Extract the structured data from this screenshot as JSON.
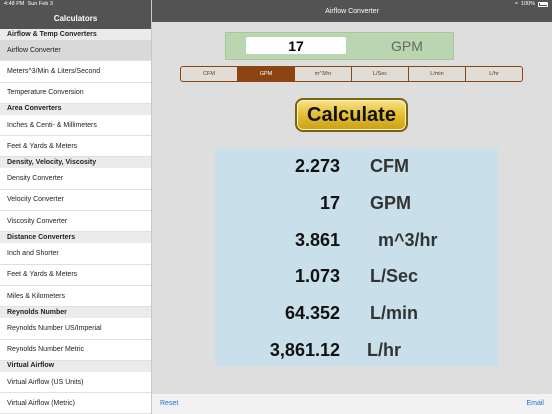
{
  "status": {
    "time": "4:48 PM",
    "date": "Sun Feb 3",
    "battery": "100%"
  },
  "sidebar": {
    "title": "Calculators",
    "groups": [
      {
        "section": "Airflow & Temp Converters",
        "items": [
          {
            "label": "Airflow Converter",
            "selected": true
          },
          {
            "label": "Meters^3/Min & Liters/Second"
          },
          {
            "label": "Temperature Conversion"
          }
        ]
      },
      {
        "section": "Area Converters",
        "items": [
          {
            "label": "Inches & Centi- & Millimeters"
          },
          {
            "label": "Feet & Yards & Meters"
          }
        ]
      },
      {
        "section": "Density, Velocity, Viscosity",
        "items": [
          {
            "label": "Density Converter"
          },
          {
            "label": "Velocity Converter"
          },
          {
            "label": "Viscosity Converter"
          }
        ]
      },
      {
        "section": "Distance Converters",
        "items": [
          {
            "label": "Inch and Shorter"
          },
          {
            "label": "Feet & Yards & Meters"
          },
          {
            "label": "Miles & Kilometers"
          }
        ]
      },
      {
        "section": "Reynolds Number",
        "items": [
          {
            "label": "Reynolds Number US/Imperial"
          },
          {
            "label": "Reynolds Number Metric"
          }
        ]
      },
      {
        "section": "Virtual Airflow",
        "items": [
          {
            "label": "Virtual Airflow (US Units)"
          },
          {
            "label": "Virtual Airflow (Metric)"
          }
        ]
      }
    ]
  },
  "main": {
    "title": "Airflow Converter",
    "input": {
      "value": "17",
      "unit": "GPM"
    },
    "units": [
      "CFM",
      "GPM",
      "m^3/hr",
      "L/Sec",
      "L/min",
      "L/hr"
    ],
    "selected_unit": "GPM",
    "calculate_label": "Calculate",
    "results": [
      {
        "value": "2.273",
        "unit": "CFM"
      },
      {
        "value": "17",
        "unit": "GPM"
      },
      {
        "value": "3.861",
        "unit": "m^3/hr"
      },
      {
        "value": "1.073",
        "unit": "L/Sec"
      },
      {
        "value": "64.352",
        "unit": "L/min"
      },
      {
        "value": "3,861.12",
        "unit": "L/hr"
      }
    ],
    "reset_label": "Reset",
    "email_label": "Email"
  },
  "colors": {
    "nav": "#535353",
    "input_bg": "#bad6b0",
    "segment": "#8b4513",
    "results_bg": "#c9dfea",
    "button": "#e3bb2a",
    "link": "#1f6fcf"
  }
}
